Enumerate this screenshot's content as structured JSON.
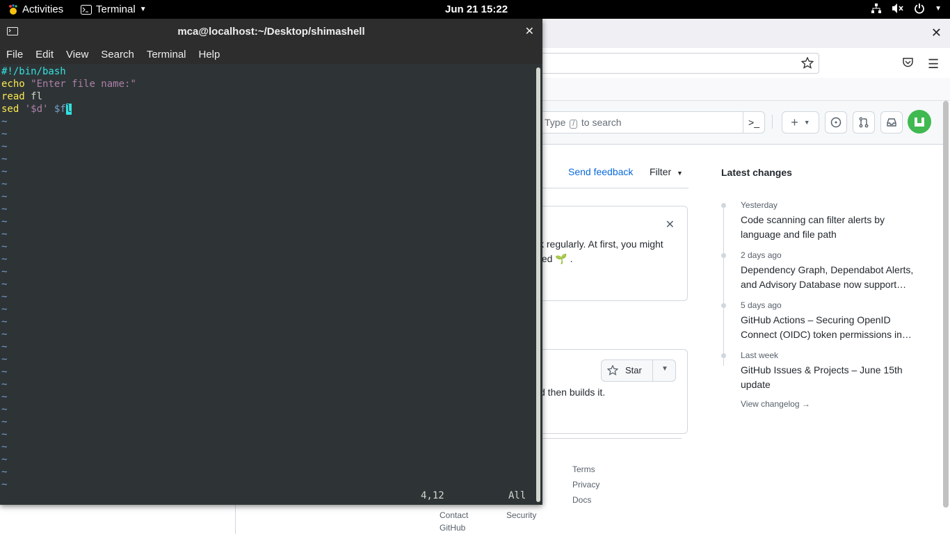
{
  "topbar": {
    "activities": "Activities",
    "app_name": "Terminal",
    "clock": "Jun 21  15:22"
  },
  "browser": {
    "search_placeholder_prefix": "Type",
    "search_slash": "/",
    "search_placeholder_suffix": "to search",
    "send_feedback": "Send feedback",
    "filter": "Filter",
    "card1_line1": "k regularly. At first, you might",
    "card1_line2": "ted 🌱 .",
    "star_label": "Star",
    "card2_text": "d then builds it.",
    "latest_changes_title": "Latest changes",
    "changelog": [
      {
        "when": "Yesterday",
        "what": "Code scanning can filter alerts by language and file path"
      },
      {
        "when": "2 days ago",
        "what": "Dependency Graph, Dependabot Alerts, and Advisory Database now support…"
      },
      {
        "when": "5 days ago",
        "what": "GitHub Actions – Securing OpenID Connect (OIDC) token permissions in…"
      },
      {
        "when": "Last week",
        "what": "GitHub Issues & Projects – June 15th update"
      }
    ],
    "view_changelog": "View changelog →",
    "footer": {
      "terms": "Terms",
      "privacy": "Privacy",
      "docs": "Docs",
      "contact_line1": "Contact",
      "contact_line2": "GitHub",
      "security": "Security"
    }
  },
  "terminal": {
    "title": "mca@localhost:~/Desktop/shimashell",
    "menu": [
      "File",
      "Edit",
      "View",
      "Search",
      "Terminal",
      "Help"
    ],
    "code": {
      "shebang": "#!/bin/bash",
      "echo_kw": "echo",
      "echo_str": "\"Enter file name:\"",
      "read_kw": "read",
      "read_var": "fl",
      "sed_kw": "sed",
      "sed_expr": "'$d'",
      "sed_var_prefix": "$f",
      "sed_var_cursor": "l"
    },
    "tilde": "~",
    "cursor_pos": "4,12",
    "scroll_pos": "All"
  }
}
